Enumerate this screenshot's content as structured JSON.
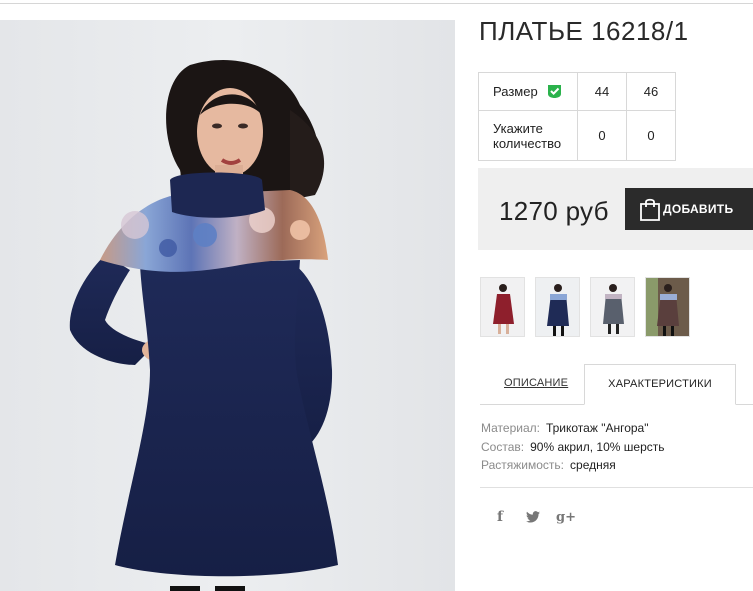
{
  "product": {
    "title": "ПЛАТЬЕ 16218/1",
    "image_alt": "Модель в синем платье с цветочной вставкой"
  },
  "size_table": {
    "size_label": "Размер",
    "quantity_label": "Укажите количество",
    "sizes": [
      "44",
      "46"
    ],
    "quantities": [
      "0",
      "0"
    ]
  },
  "purchase": {
    "price": "1270 руб",
    "add_button_label": "ДОБАВИТЬ"
  },
  "thumbnails": [
    {
      "name": "thumbnail-burgundy-dress",
      "color": "#8e1f2c"
    },
    {
      "name": "thumbnail-navy-floral-dress",
      "color": "#1f2b56"
    },
    {
      "name": "thumbnail-grey-dress",
      "color": "#59606d"
    },
    {
      "name": "thumbnail-brown-dress",
      "color": "#5a3f3d"
    }
  ],
  "tabs": {
    "description": "ОПИСАНИЕ",
    "characteristics": "ХАРАКТЕРИСТИКИ",
    "active": "characteristics"
  },
  "specs": [
    {
      "key": "Материал:",
      "value": "Трикотаж \"Ангора\""
    },
    {
      "key": "Состав:",
      "value": "90% акрил, 10% шерсть"
    },
    {
      "key": "Растяжимость:",
      "value": "средняя"
    }
  ],
  "social": {
    "facebook_icon": "f",
    "twitter_icon": "twitter-bird-icon",
    "googleplus_icon": "g+"
  },
  "colors": {
    "dress_navy": "#1e2855",
    "button_dark": "#2b2b2b",
    "check_green": "#2bb24c",
    "price_bg": "#efefef"
  }
}
